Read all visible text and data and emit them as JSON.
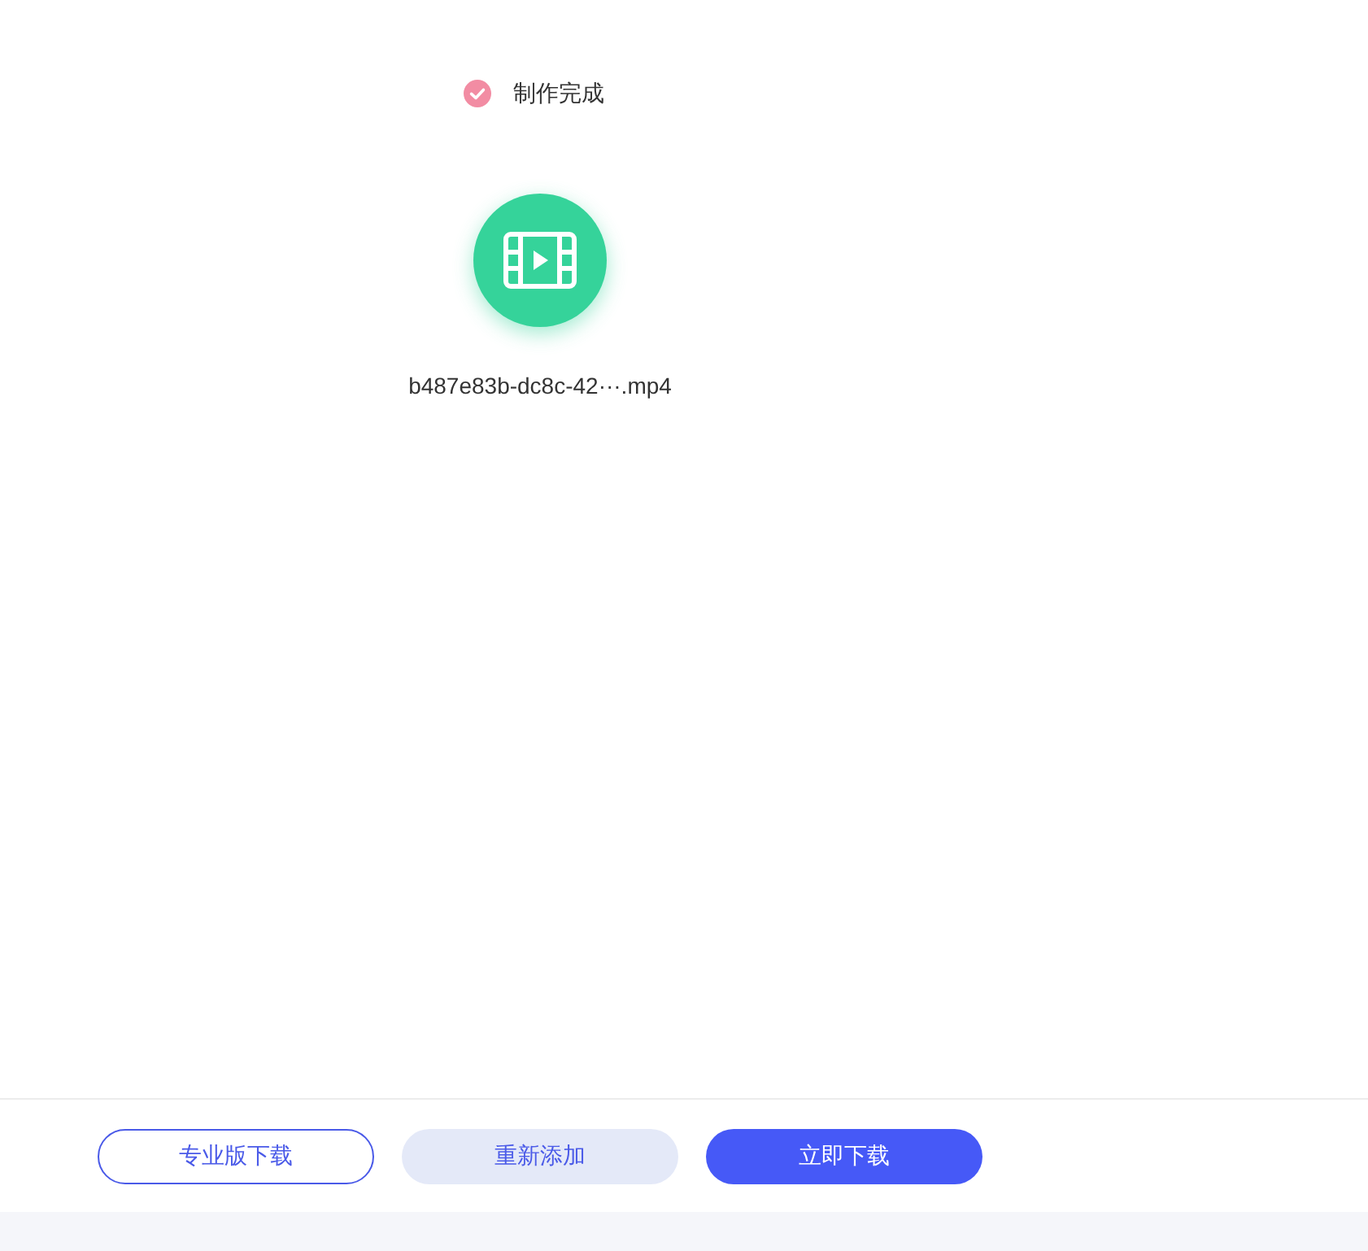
{
  "status": {
    "text": "制作完成",
    "done": true
  },
  "file": {
    "name": "b487e83b-dc8c-42···.mp4"
  },
  "buttons": [
    {
      "label": "专业版下载",
      "kind": "outline"
    },
    {
      "label": "重新添加",
      "kind": "soft"
    },
    {
      "label": "立即下载",
      "kind": "primary"
    }
  ]
}
